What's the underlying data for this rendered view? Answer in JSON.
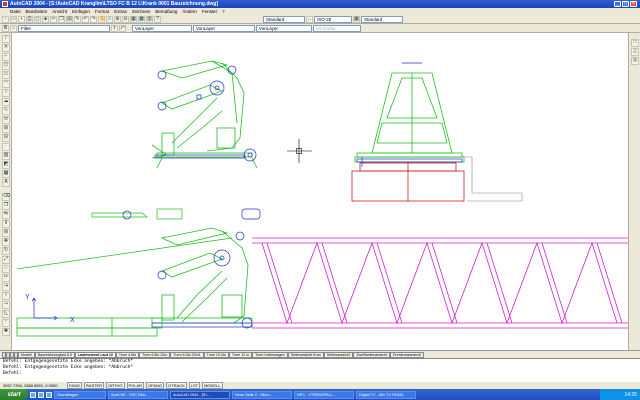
{
  "window": {
    "title": "AutoCAD 2004 - [S:\\AutoCAD Kranglim\\LTSO FC B 12 L\\Krank 0001 Bauzeichnung.dwg]"
  },
  "menu": [
    "Datei",
    "Bearbeiten",
    "Ansicht",
    "Einfügen",
    "Format",
    "Extras",
    "Zeichnen",
    "Bemaßung",
    "Ändern",
    "Fenster",
    "?"
  ],
  "toolbar": {
    "textstyle": "Standard",
    "dimstyle": "ISO-25",
    "tablestyle": "Standard",
    "layer": "Filter",
    "color": "VonLayer",
    "linetype": "VonLayer",
    "lineweight": "VonLayer",
    "plotstyle": "VonFarbe"
  },
  "tabs": [
    "Modell",
    "Bauzeichnunglast 8.0",
    "Lastmoment Laut 10",
    "Turm 4.5to",
    "Turm 6.5to 20m",
    "Turm 6.0to 20m1",
    "Turm 10.0to",
    "Turm 12 m",
    "Turm Untenwagen",
    "Seitenansicht Kran",
    "Seitenansicht2",
    "Zweiflankenansicht",
    "Drehkranzansicht"
  ],
  "command": {
    "lines": [
      "Befehl: Entgegengesetzte Ecke angeben: *Abbruch*",
      "Befehl: Entgegengesetzte Ecke angeben: *Abbruch*",
      "Befehl:"
    ]
  },
  "status": {
    "coords": "3097.7394, 2860.8591, 0.0000",
    "toggles": [
      "FANG",
      "RASTER",
      "ORTHO",
      "POLAR",
      "OFANG",
      "OTRACK",
      "LST",
      "MODELL"
    ]
  },
  "taskbar": {
    "start": "start",
    "items": [
      "Grundfragen",
      "Spiel NE - DSC Betr...",
      "AutoCAD 2004 - [S:\\...",
      "Neue Seite 2 - Micro...",
      "NPC - VTREM2PALL...",
      "Digital TV - Win TV ROMA"
    ],
    "clock": "14:35"
  },
  "colors": {
    "green": "#1fbf1f",
    "magenta": "#cc22cc",
    "blue": "#1e2fcc",
    "red": "#cc2222"
  },
  "ucs": {
    "x_label": "X",
    "y_label": "Y"
  }
}
